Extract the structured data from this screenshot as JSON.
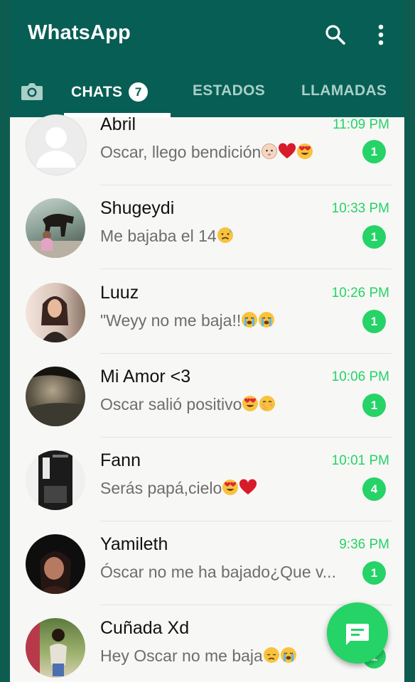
{
  "app_bar": {
    "title": "WhatsApp",
    "icons": [
      "search-icon",
      "more-vert-icon"
    ]
  },
  "tabs": {
    "camera_icon": "camera-icon",
    "chats": "CHATS",
    "chats_badge": "7",
    "estados": "ESTADOS",
    "llamadas": "LLAMADAS"
  },
  "chats": [
    {
      "name": "Abril",
      "time": "11:09 PM",
      "preview": "Oscar, llego bendición",
      "preview_emojis": [
        "baby-emoji",
        "red-heart-emoji",
        "heart-eyes-emoji"
      ],
      "unread": "1"
    },
    {
      "name": "Shugeydi",
      "time": "10:33 PM",
      "preview": "Me bajaba el 14",
      "preview_emojis": [
        "sad-sweat-emoji"
      ],
      "unread": "1"
    },
    {
      "name": "Luuz",
      "time": "10:26 PM",
      "preview": "\"Weyy no me baja!!",
      "preview_emojis": [
        "crying-emoji",
        "crying-emoji"
      ],
      "unread": "1"
    },
    {
      "name": "Mi Amor <3",
      "time": "10:06 PM",
      "preview": "Oscar salió positivo",
      "preview_emojis": [
        "heart-eyes-emoji",
        "blushing-emoji"
      ],
      "unread": "1"
    },
    {
      "name": "Fann",
      "time": "10:01 PM",
      "preview": "Serás papá,cielo",
      "preview_emojis": [
        "heart-eyes-emoji",
        "red-heart-emoji"
      ],
      "unread": "4"
    },
    {
      "name": "Yamileth",
      "time": "9:36 PM",
      "preview": "Óscar no me ha bajado¿Que v...",
      "preview_emojis": [],
      "unread": "1"
    },
    {
      "name": "Cuñada Xd",
      "time": "",
      "preview": "Hey Oscar no me baja",
      "preview_emojis": [
        "sad-emoji",
        "crying-emoji"
      ],
      "unread": "1"
    }
  ],
  "colors": {
    "header": "#075e54",
    "accent": "#25d366",
    "background": "#0e5c4f"
  },
  "fab": {
    "icon": "new-chat-icon"
  }
}
